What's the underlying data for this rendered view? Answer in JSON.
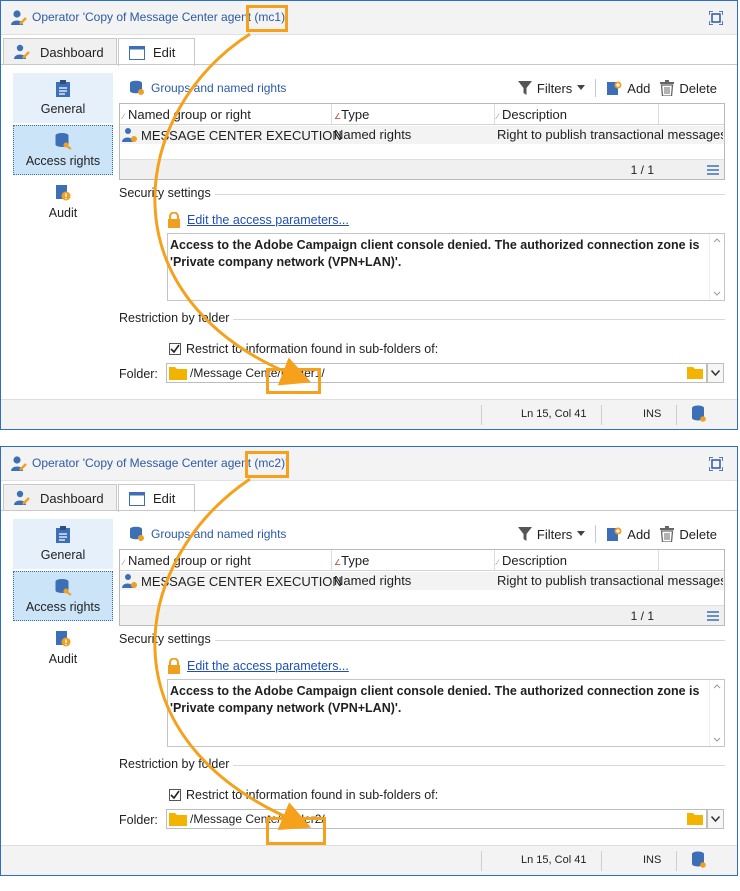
{
  "colors": {
    "accent": "#2b5aa8",
    "highlight": "#f5a11c",
    "selected_bg": "#cce4f7"
  },
  "panels": [
    {
      "title": "Operator 'Copy of Message Center agent (mc1)'",
      "highlight_text": "(mc1)",
      "tabs": [
        {
          "label": "Dashboard"
        },
        {
          "label": "Edit"
        }
      ],
      "sidebar": [
        {
          "label": "General",
          "icon": "clipboard-icon"
        },
        {
          "label": "Access rights",
          "icon": "database-key-icon"
        },
        {
          "label": "Audit",
          "icon": "audit-icon"
        }
      ],
      "toolbar": {
        "groups_label": "Groups and named rights",
        "filters": "Filters",
        "add": "Add",
        "delete": "Delete"
      },
      "grid": {
        "columns": [
          "Named group or right",
          "Type",
          "Description"
        ],
        "rows": [
          {
            "name": "MESSAGE CENTER EXECUTION",
            "type": "Named rights",
            "description": "Right to publish transactional messages"
          }
        ],
        "pagination": "1 / 1"
      },
      "security": {
        "title": "Security settings",
        "link": "Edit the access parameters...",
        "message": "Access to the Adobe Campaign client console denied. The authorized connection zone is 'Private company network (VPN+LAN)'."
      },
      "restriction": {
        "title": "Restriction by folder",
        "checkbox_label": "Restrict to information found in sub-folders of:",
        "checked": true,
        "folder_label": "Folder:",
        "folder_prefix": "/Message Cente",
        "folder_highlight": "/Folder1/"
      },
      "status": {
        "position": "Ln 15, Col 41",
        "mode": "INS"
      }
    },
    {
      "title": "Operator 'Copy of Message Center agent (mc2)'",
      "highlight_text": "(mc2)",
      "tabs": [
        {
          "label": "Dashboard"
        },
        {
          "label": "Edit"
        }
      ],
      "sidebar": [
        {
          "label": "General",
          "icon": "clipboard-icon"
        },
        {
          "label": "Access rights",
          "icon": "database-key-icon"
        },
        {
          "label": "Audit",
          "icon": "audit-icon"
        }
      ],
      "toolbar": {
        "groups_label": "Groups and named rights",
        "filters": "Filters",
        "add": "Add",
        "delete": "Delete"
      },
      "grid": {
        "columns": [
          "Named group or right",
          "Type",
          "Description"
        ],
        "rows": [
          {
            "name": "MESSAGE CENTER EXECUTION",
            "type": "Named rights",
            "description": "Right to publish transactional messages"
          }
        ],
        "pagination": "1 / 1"
      },
      "security": {
        "title": "Security settings",
        "link": "Edit the access parameters...",
        "message": "Access to the Adobe Campaign client console denied. The authorized connection zone is 'Private company network (VPN+LAN)'."
      },
      "restriction": {
        "title": "Restriction by folder",
        "checkbox_label": "Restrict to information found in sub-folders of:",
        "checked": true,
        "folder_label": "Folder:",
        "folder_prefix": "/Message Cente",
        "folder_highlight": "/Folder2/"
      },
      "status": {
        "position": "Ln 15, Col 41",
        "mode": "INS"
      }
    }
  ]
}
